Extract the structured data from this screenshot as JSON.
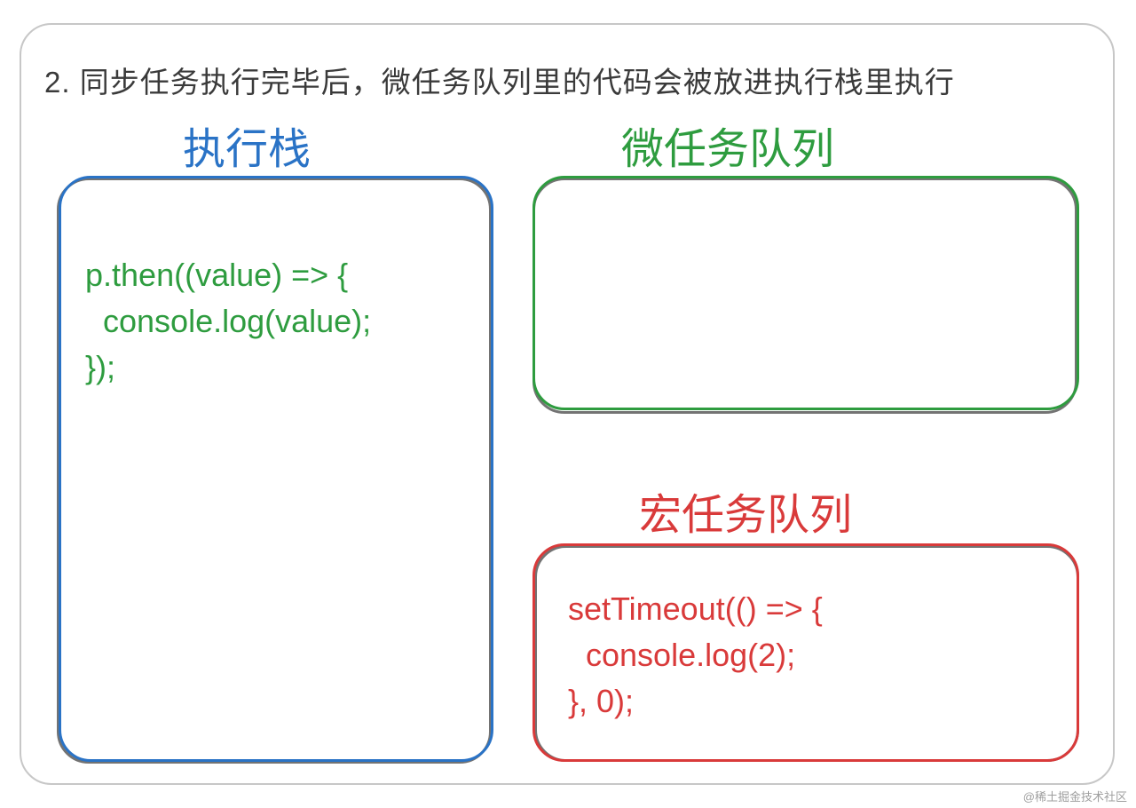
{
  "step_title": "2. 同步任务执行完毕后，微任务队列里的代码会被放进执行栈里执行",
  "stack": {
    "label": "执行栈",
    "code": "p.then((value) => {\n  console.log(value);\n});"
  },
  "micro": {
    "label": "微任务队列",
    "code": ""
  },
  "macro": {
    "label": "宏任务队列",
    "code": "setTimeout(() => {\n  console.log(2);\n}, 0);"
  },
  "colors": {
    "stack": "#2a73c6",
    "micro": "#2e9c3f",
    "macro": "#d93a3a",
    "frame": "#c7c7c7"
  },
  "watermark": "@稀土掘金技术社区"
}
